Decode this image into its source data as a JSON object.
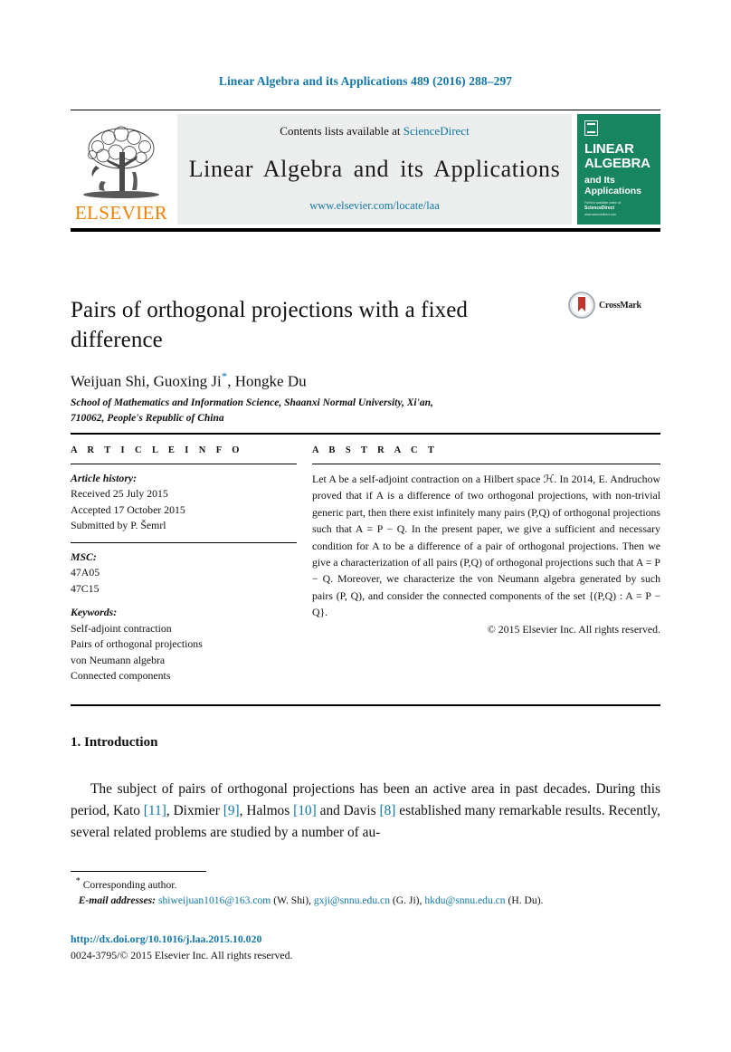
{
  "running_head": "Linear Algebra and its Applications 489 (2016) 288–297",
  "masthead": {
    "contents_prefix": "Contents lists available at ",
    "sciencedirect": "ScienceDirect",
    "journal_title": "Linear Algebra and its Applications",
    "journal_url": "www.elsevier.com/locate/laa",
    "publisher_wordmark": "ELSEVIER",
    "cover": {
      "line1": "LINEAR",
      "line2": "ALGEBRA",
      "line3": "and Its",
      "line4": "Applications",
      "footer_top": "Full text available online at",
      "footer_brand": "ScienceDirect",
      "footer_bottom": "www.sciencedirect.com"
    }
  },
  "article": {
    "title": "Pairs of orthogonal projections with a fixed difference",
    "crossmark_label": "CrossMark",
    "authors": "Weijuan Shi, Guoxing Ji",
    "authors_star": "*",
    "authors_tail": ", Hongke Du",
    "affiliation_line1": "School of Mathematics and Information Science, Shaanxi Normal University, Xi'an,",
    "affiliation_line2": "710062, People's Republic of China"
  },
  "info": {
    "heading": "A R T I C L E   I N F O",
    "history_head": "Article history:",
    "history": [
      "Received 25 July 2015",
      "Accepted 17 October 2015",
      "Submitted by P. Šemrl"
    ],
    "msc_head": "MSC:",
    "msc": [
      "47A05",
      "47C15"
    ],
    "keywords_head": "Keywords:",
    "keywords": [
      "Self-adjoint contraction",
      "Pairs of orthogonal projections",
      "von Neumann algebra",
      "Connected components"
    ]
  },
  "abstract": {
    "heading": "A B S T R A C T",
    "body": "Let A be a self-adjoint contraction on a Hilbert space ℋ. In 2014, E. Andruchow proved that if A is a difference of two orthogonal projections, with non-trivial generic part, then there exist infinitely many pairs (P,Q) of orthogonal projections such that A = P − Q. In the present paper, we give a sufficient and necessary condition for A to be a difference of a pair of orthogonal projections. Then we give a characterization of all pairs (P,Q) of orthogonal projections such that A = P − Q. Moreover, we characterize the von Neumann algebra generated by such pairs (P, Q), and consider the connected components of the set {(P,Q) : A = P − Q}.",
    "copyright": "© 2015 Elsevier Inc. All rights reserved."
  },
  "body_section": {
    "heading": "1. Introduction",
    "paragraph_part1": "The subject of pairs of orthogonal projections has been an active area in past decades. During this period, Kato ",
    "cite1": "[11]",
    "paragraph_part2": ", Dixmier ",
    "cite2": "[9]",
    "paragraph_part3": ", Halmos ",
    "cite3": "[10]",
    "paragraph_part4": " and Davis ",
    "cite4": "[8]",
    "paragraph_part5": " established many remarkable results. Recently, several related problems are studied by a number of au-"
  },
  "footnotes": {
    "corresponding_star": "*",
    "corresponding": "Corresponding author.",
    "email_label": "E-mail addresses:",
    "email1": "shiweijuan1016@163.com",
    "email1_author": "(W. Shi),",
    "email2": "gxji@snnu.edu.cn",
    "email2_author": "(G. Ji),",
    "email3": "hkdu@snnu.edu.cn",
    "email3_author": "(H. Du).",
    "doi": "http://dx.doi.org/10.1016/j.laa.2015.10.020",
    "issn": "0024-3795/© 2015 Elsevier Inc. All rights reserved."
  },
  "colors": {
    "link_blue": "#1277a8",
    "elsevier_orange": "#f08000",
    "cover_green": "#17855f",
    "crossmark_red": "#c0342b"
  }
}
